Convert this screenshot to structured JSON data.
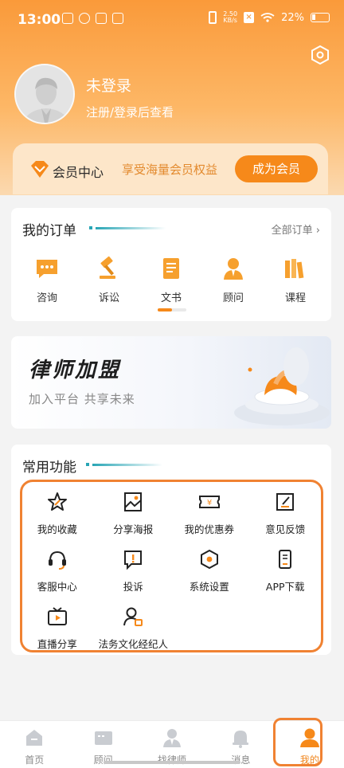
{
  "status_bar": {
    "time": "13:00",
    "net_speed_value": "2.50",
    "net_speed_unit": "KB/s",
    "battery": "22%"
  },
  "profile": {
    "title": "未登录",
    "subtitle": "注册/登录后查看"
  },
  "vip": {
    "title": "会员中心",
    "subtitle": "享受海量会员权益",
    "button": "成为会员"
  },
  "orders": {
    "title": "我的订单",
    "all_label": "全部订单",
    "items": [
      {
        "label": "咨询",
        "icon": "chat-icon"
      },
      {
        "label": "诉讼",
        "icon": "gavel-icon"
      },
      {
        "label": "文书",
        "icon": "document-icon"
      },
      {
        "label": "顾问",
        "icon": "advisor-icon"
      },
      {
        "label": "课程",
        "icon": "books-icon"
      }
    ],
    "page_indicator_progress": 0.5
  },
  "banner": {
    "title": "律师加盟",
    "subtitle": "加入平台 共享未来"
  },
  "functions": {
    "title": "常用功能",
    "items": [
      {
        "label": "我的收藏",
        "icon": "star-icon"
      },
      {
        "label": "分享海报",
        "icon": "poster-icon"
      },
      {
        "label": "我的优惠券",
        "icon": "coupon-icon"
      },
      {
        "label": "意见反馈",
        "icon": "feedback-icon"
      },
      {
        "label": "客服中心",
        "icon": "headset-icon"
      },
      {
        "label": "投诉",
        "icon": "complaint-icon"
      },
      {
        "label": "系统设置",
        "icon": "settings-hex-icon"
      },
      {
        "label": "APP下载",
        "icon": "phone-icon"
      },
      {
        "label": "直播分享",
        "icon": "tv-icon"
      },
      {
        "label": "法务文化经纪人",
        "icon": "agent-icon"
      }
    ]
  },
  "tabbar": {
    "items": [
      {
        "label": "首页",
        "icon": "home-icon"
      },
      {
        "label": "顾问",
        "icon": "advisor-tab-icon"
      },
      {
        "label": "找律师",
        "icon": "lawyer-icon"
      },
      {
        "label": "消息",
        "icon": "bell-icon"
      },
      {
        "label": "我的",
        "icon": "person-icon"
      }
    ],
    "active_index": 4
  },
  "colors": {
    "accent": "#f6891a",
    "teal": "#28a5b5",
    "highlight": "#f08232"
  }
}
